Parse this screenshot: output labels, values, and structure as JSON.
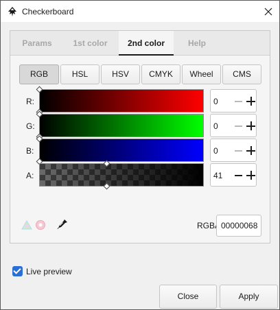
{
  "window": {
    "title": "Checkerboard",
    "icon": "inkscape-logo-icon",
    "close_icon": "close-icon"
  },
  "tabs": [
    {
      "label": "Params",
      "active": false
    },
    {
      "label": "1st color",
      "active": false
    },
    {
      "label": "2nd color",
      "active": true
    },
    {
      "label": "Help",
      "active": false
    }
  ],
  "color_modes": [
    {
      "label": "RGB",
      "selected": true
    },
    {
      "label": "HSL",
      "selected": false
    },
    {
      "label": "HSV",
      "selected": false
    },
    {
      "label": "CMYK",
      "selected": false
    },
    {
      "label": "Wheel",
      "selected": false
    },
    {
      "label": "CMS",
      "selected": false
    }
  ],
  "channels": [
    {
      "label": "R:",
      "value": "0",
      "level": 0.0,
      "color": "#ff0000"
    },
    {
      "label": "G:",
      "value": "0",
      "level": 0.0,
      "color": "#00ff00"
    },
    {
      "label": "B:",
      "value": "0",
      "level": 0.0,
      "color": "#0000ff"
    },
    {
      "label": "A:",
      "value": "41",
      "level": 0.41,
      "color": "#000000"
    }
  ],
  "tools": {
    "color_managed_icon": "color-managed-icon",
    "out_of_gamut_icon": "out-of-gamut-icon",
    "picker_icon": "eyedropper-icon"
  },
  "rgba": {
    "label": "RGBA:",
    "value": "00000068"
  },
  "live_preview": {
    "label": "Live preview",
    "checked": true
  },
  "buttons": {
    "close": "Close",
    "apply": "Apply"
  },
  "colors": {
    "accent": "#2a6fd6",
    "tab_inactive": "#a8a8a8"
  }
}
